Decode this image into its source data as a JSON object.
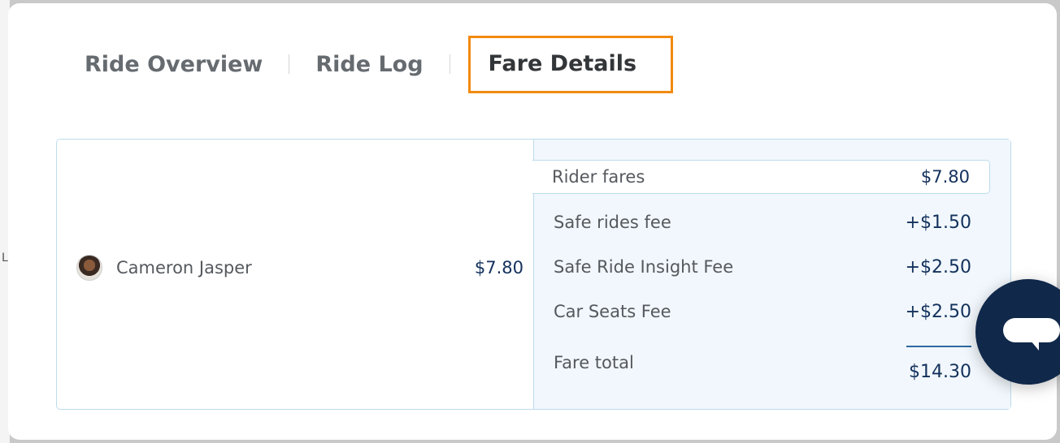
{
  "backdrop": {
    "edge_char": "L"
  },
  "tabs": [
    {
      "label": "Ride Overview",
      "active": false
    },
    {
      "label": "Ride Log",
      "active": false
    },
    {
      "label": "Fare Details",
      "active": true
    }
  ],
  "fare": {
    "rider": {
      "name": "Cameron Jasper",
      "amount": "$7.80",
      "avatar_icon": "user-avatar"
    },
    "rider_fares": {
      "label": "Rider fares",
      "amount": "$7.80"
    },
    "fees": [
      {
        "label": "Safe rides fee",
        "amount": "+$1.50"
      },
      {
        "label": "Safe Ride Insight Fee",
        "amount": "+$2.50"
      },
      {
        "label": "Car Seats Fee",
        "amount": "+$2.50"
      }
    ],
    "total": {
      "label": "Fare total",
      "amount": "$14.30"
    }
  },
  "chat": {
    "icon": "chat-bubble-icon"
  },
  "colors": {
    "active_tab_outline": "#f28a0f",
    "amount_text": "#13315c",
    "card_border": "#bcdcec",
    "chat_button": "#10284a"
  }
}
